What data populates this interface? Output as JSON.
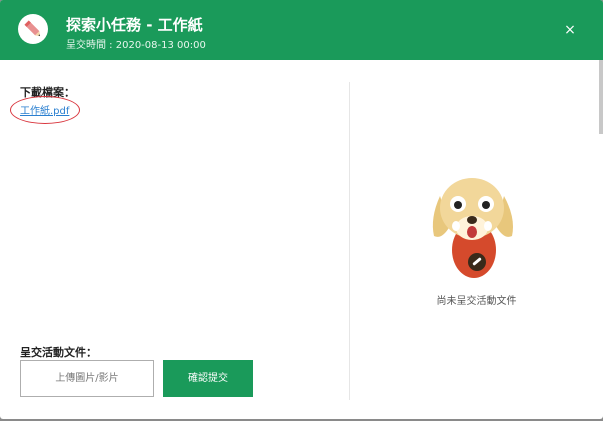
{
  "header": {
    "title": "探索小任務 - 工作紙",
    "submit_time": "呈交時間 : 2020-08-13 00:00",
    "close_label": "×"
  },
  "download": {
    "title": "下載檔案：",
    "file_name": "工作紙.pdf"
  },
  "submission": {
    "title": "呈交活動文件：",
    "upload_label": "上傳圖片/影片",
    "submit_label": "確認提交"
  },
  "empty_state": {
    "text": "尚未呈交活動文件"
  },
  "colors": {
    "primary": "#1a9a5a",
    "link": "#2a7fd0",
    "annotation": "#d9363e"
  }
}
